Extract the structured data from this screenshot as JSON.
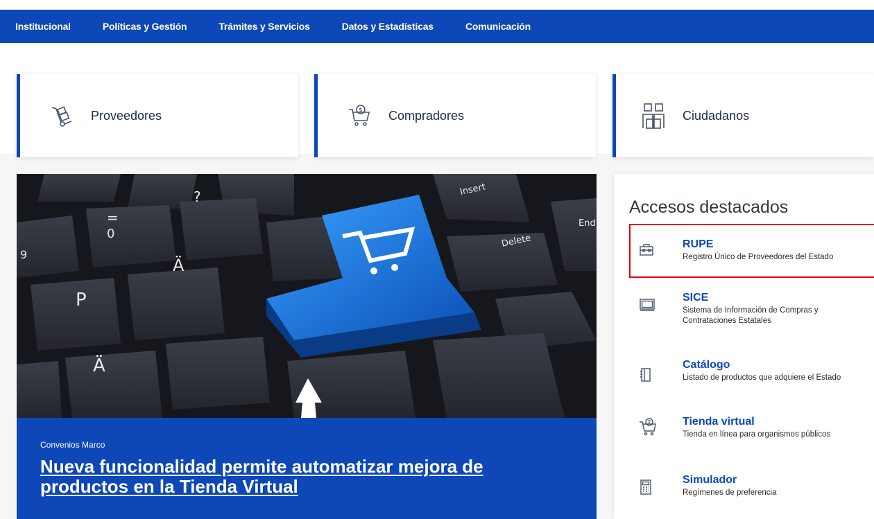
{
  "nav": {
    "items": [
      "Institucional",
      "Políticas y Gestión",
      "Trámites y Servicios",
      "Datos y Estadísticas",
      "Comunicación"
    ]
  },
  "roles": [
    {
      "label": "Proveedores",
      "icon": "hand-truck-icon"
    },
    {
      "label": "Compradores",
      "icon": "shopping-cart-money-icon"
    },
    {
      "label": "Ciudadanos",
      "icon": "people-icon"
    }
  ],
  "hero": {
    "kicker": "Convenios Marco",
    "title": "Nueva funcionalidad permite automatizar mejora de productos en la Tienda Virtual",
    "key_labels": [
      "Insert",
      "Delete",
      "End",
      "P",
      "Ä",
      "Ä",
      "?",
      "=",
      "0",
      "9"
    ]
  },
  "access": {
    "title": "Accesos destacados",
    "items": [
      {
        "title": "RUPE",
        "desc": "Registro Único de Proveedores del Estado",
        "icon": "briefcase-icon"
      },
      {
        "title": "SICE",
        "desc": "Sistema de Información de Compras y Contrataciones Estatales",
        "icon": "monitor-icon"
      },
      {
        "title": "Catálogo",
        "desc": "Listado de productos que adquiere el Estado",
        "icon": "book-icon"
      },
      {
        "title": "Tienda virtual",
        "desc": "Tienda en línea para organismos públicos",
        "icon": "cart-icon"
      },
      {
        "title": "Simulador",
        "desc": "Regímenes de preferencia",
        "icon": "calculator-icon"
      }
    ]
  },
  "colors": {
    "primary": "#0d47b8",
    "highlight": "#e30000"
  }
}
